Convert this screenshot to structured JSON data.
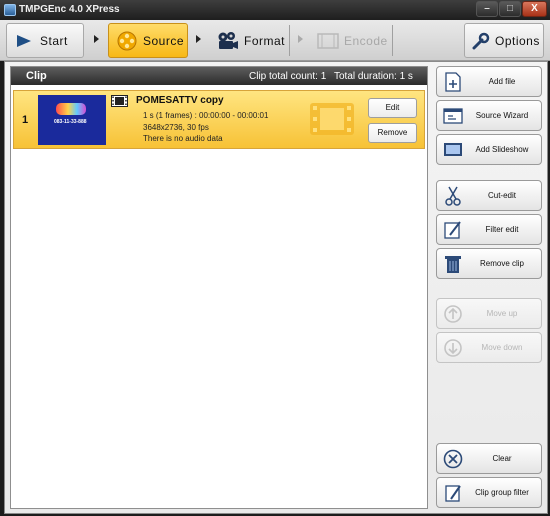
{
  "window": {
    "title": "TMPGEnc 4.0 XPress",
    "min_glyph": "–",
    "max_glyph": "□",
    "close_glyph": "X"
  },
  "toolbar": {
    "start_label": "Start",
    "source_label": "Source",
    "format_label": "Format",
    "encode_label": "Encode",
    "options_label": "Options",
    "active_tab": "Source",
    "accent_color": "#f7b815"
  },
  "clip_panel": {
    "header_title": "Clip",
    "total_count": "Clip total count: 1",
    "total_duration": "Total duration: 1 s",
    "clips": [
      {
        "index": "1",
        "thumb_text": "083-11-33-888",
        "name": "POMESATTV copy",
        "duration": "1 s (1 frames) : 00:00:00 - 00:00:01",
        "resolution": "3648x2736,  30  fps",
        "audio": "There is no audio data",
        "edit_label": "Edit",
        "remove_label": "Remove"
      }
    ]
  },
  "side_buttons": {
    "add_file": "Add file",
    "source_wizard": "Source Wizard",
    "add_slideshow": "Add Slideshow",
    "cut_edit": "Cut-edit",
    "filter_edit": "Filter edit",
    "remove_clip": "Remove clip",
    "move_up": "Move up",
    "move_down": "Move down",
    "clear": "Clear",
    "clip_group_filter": "Clip group filter"
  }
}
